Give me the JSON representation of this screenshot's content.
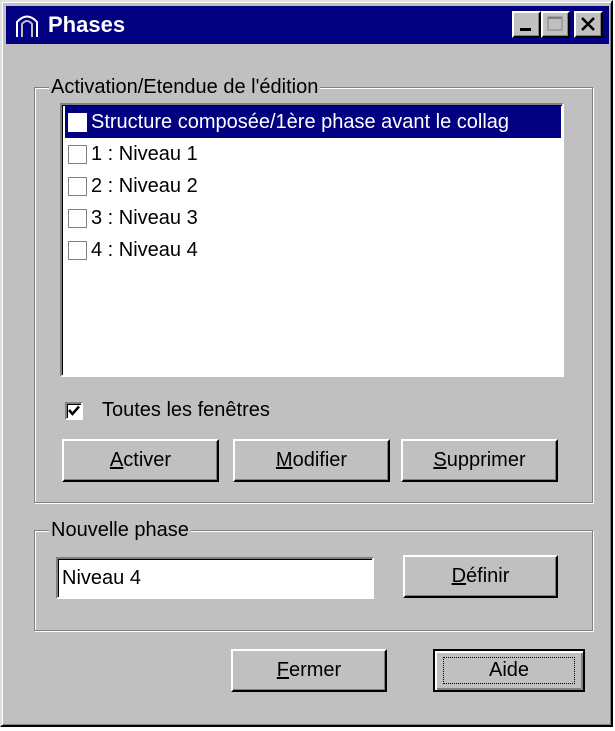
{
  "window": {
    "title": "Phases",
    "controls": {
      "minimize": "minimize-icon",
      "maximize": "maximize-icon",
      "close": "close-icon"
    }
  },
  "activation_group": {
    "label": "Activation/Etendue de l'édition",
    "phases": [
      {
        "label": "Structure composée/1ère phase avant le collag",
        "selected": true,
        "checked": false
      },
      {
        "label": "1 : Niveau 1",
        "selected": false,
        "checked": false
      },
      {
        "label": "2 : Niveau 2",
        "selected": false,
        "checked": false
      },
      {
        "label": "3 : Niveau 3",
        "selected": false,
        "checked": false
      },
      {
        "label": "4 : Niveau 4",
        "selected": false,
        "checked": false
      }
    ],
    "all_windows": {
      "label": "Toutes les fenêtres",
      "checked": true
    },
    "buttons": {
      "activate": {
        "mnemonic": "A",
        "rest": "ctiver"
      },
      "modify": {
        "mnemonic": "M",
        "rest": "odifier"
      },
      "delete": {
        "mnemonic": "S",
        "rest": "upprimer"
      }
    }
  },
  "new_phase_group": {
    "label": "Nouvelle phase",
    "name_value": "Niveau 4",
    "define_button": {
      "mnemonic": "D",
      "rest": "éfinir"
    }
  },
  "footer": {
    "close_button": {
      "mnemonic": "F",
      "rest": "ermer"
    },
    "help_button": {
      "label": "Aide"
    }
  },
  "colors": {
    "face": "#c0c0c0",
    "titlebar": "#000080",
    "selection": "#000080"
  }
}
